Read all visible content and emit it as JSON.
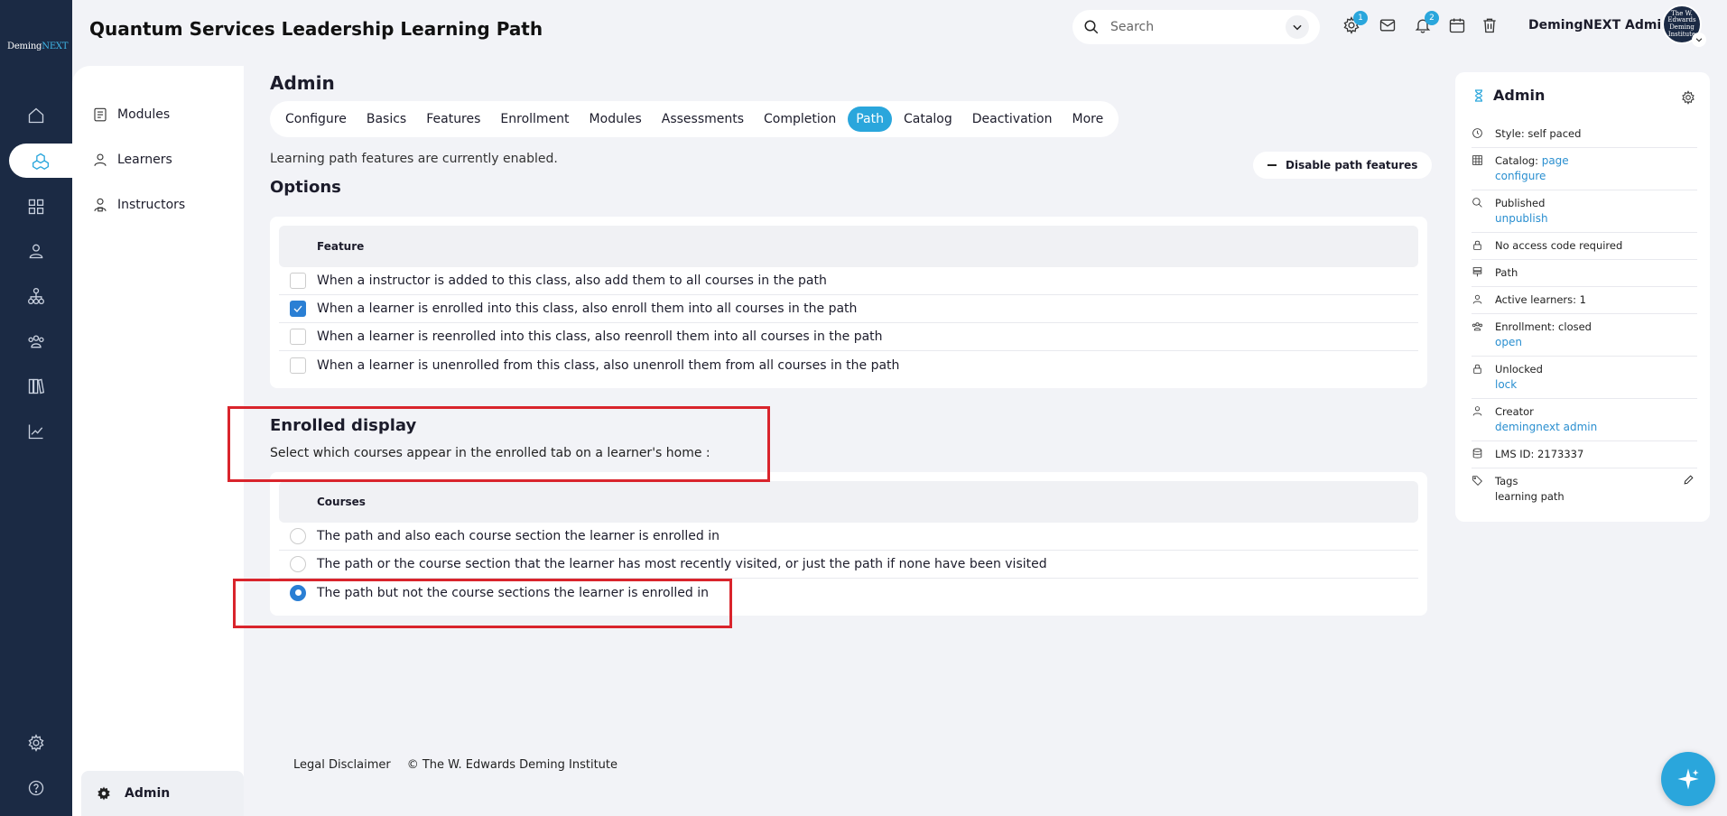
{
  "brand": {
    "logo_main": "Deming",
    "logo_accent": "NEXT"
  },
  "header": {
    "title": "Quantum Services Leadership Learning Path",
    "search_placeholder": "Search",
    "notifications": {
      "settings_badge": "1",
      "bell_badge": "2"
    },
    "user_name": "DemingNEXT Admin",
    "avatar_text": "The W. Edwards Deming Institute"
  },
  "subnav": {
    "items": [
      {
        "label": "Modules",
        "icon": "modules-icon"
      },
      {
        "label": "Learners",
        "icon": "person-icon"
      },
      {
        "label": "Instructors",
        "icon": "instructor-icon"
      }
    ],
    "admin_label": "Admin"
  },
  "main": {
    "section_title": "Admin",
    "tabs": [
      "Configure",
      "Basics",
      "Features",
      "Enrollment",
      "Modules",
      "Assessments",
      "Completion",
      "Path",
      "Catalog",
      "Deactivation",
      "More"
    ],
    "active_tab": "Path",
    "status_text": "Learning path features are currently enabled.",
    "disable_button": "Disable path features",
    "options_title": "Options",
    "feature_header": "Feature",
    "features": [
      {
        "label": "When a instructor is added to this class, also add them to all courses in the path",
        "checked": false
      },
      {
        "label": "When a learner is enrolled into this class, also enroll them into all courses in the path",
        "checked": true
      },
      {
        "label": "When a learner is reenrolled into this class, also reenroll them into all courses in the path",
        "checked": false
      },
      {
        "label": "When a learner is unenrolled from this class, also unenroll them from all courses in the path",
        "checked": false
      }
    ],
    "enrolled_title": "Enrolled display",
    "enrolled_subtitle": "Select which courses appear in the enrolled tab on a learner's home :",
    "courses_header": "Courses",
    "course_options": [
      {
        "label": "The path and also each course section the learner is enrolled in",
        "selected": false
      },
      {
        "label": "The path or the course section that the learner has most recently visited, or just the path if none have been visited",
        "selected": false
      },
      {
        "label": "The path but not the course sections the learner is enrolled in",
        "selected": true
      }
    ]
  },
  "footer": {
    "disclaimer": "Legal Disclaimer",
    "copyright": "© The W. Edwards Deming Institute"
  },
  "right_panel": {
    "title": "Admin",
    "items": {
      "style": "Style: self paced",
      "catalog_label": "Catalog:",
      "catalog_link1": "page",
      "catalog_link2": "configure",
      "published": "Published",
      "unpublish": "unpublish",
      "access": "No access code required",
      "path": "Path",
      "active_learners": "Active learners: 1",
      "enrollment": "Enrollment: closed",
      "enrollment_link": "open",
      "unlocked": "Unlocked",
      "lock_link": "lock",
      "creator": "Creator",
      "creator_link": "demingnext admin",
      "lms_id": "LMS ID: 2173337",
      "tags": "Tags",
      "tags_value": "learning path"
    }
  },
  "colors": {
    "accent": "#2aa6dc",
    "rail": "#1b2a44",
    "highlight": "#d9242c",
    "check": "#2a7fd4"
  }
}
